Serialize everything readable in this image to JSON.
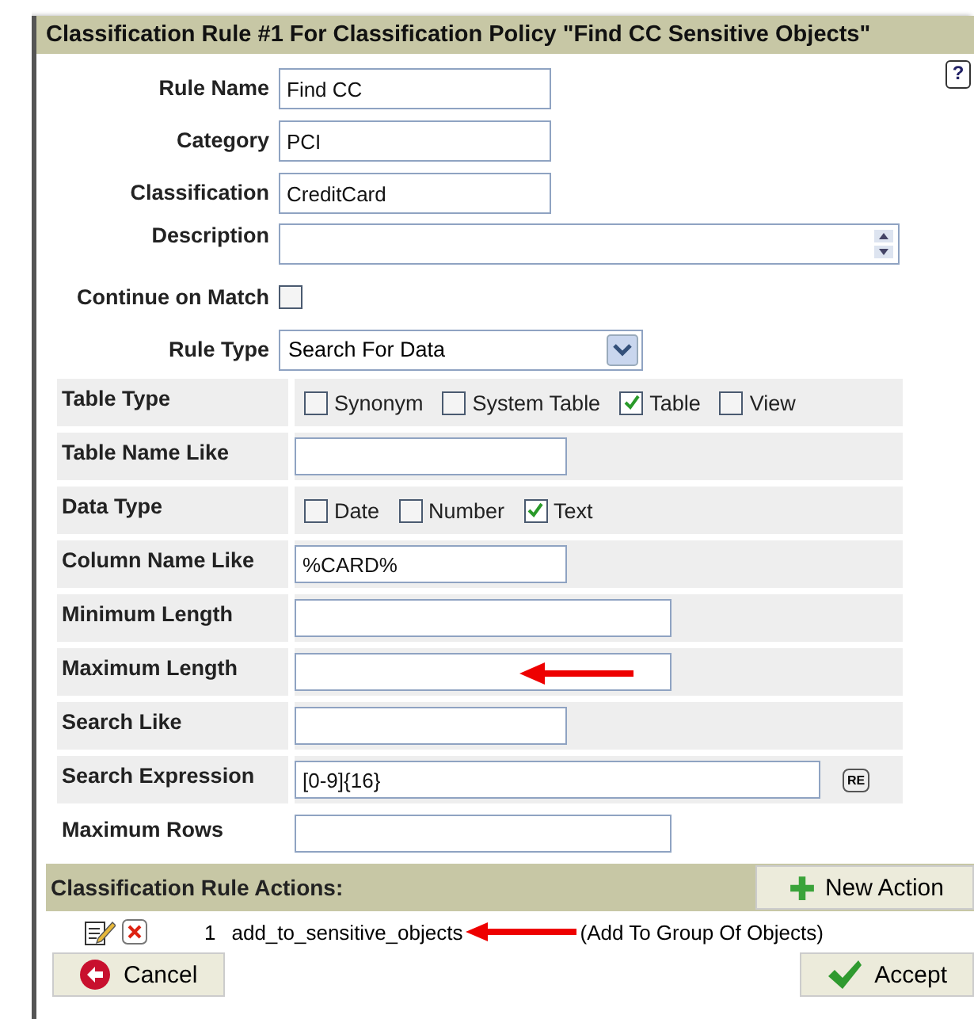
{
  "dialog": {
    "title": "Classification Rule #1 For Classification Policy \"Find CC Sensitive Objects\"",
    "help": "?"
  },
  "fields": [
    {
      "kind": "text",
      "label": "Rule Name",
      "value": "Find CC"
    },
    {
      "kind": "text",
      "label": "Category",
      "value": "PCI"
    },
    {
      "kind": "text",
      "label": "Classification",
      "value": "CreditCard"
    },
    {
      "kind": "textarea",
      "label": "Description"
    },
    {
      "kind": "checkbox",
      "label": "Continue on Match",
      "checked": false
    },
    {
      "kind": "select",
      "label": "Rule Type",
      "value": "Search For Data"
    }
  ],
  "criteria": [
    {
      "kind": "checks",
      "label": "Table Type",
      "options": [
        {
          "label": "Synonym",
          "checked": false
        },
        {
          "label": "System Table",
          "checked": false
        },
        {
          "label": "Table",
          "checked": true
        },
        {
          "label": "View",
          "checked": false
        }
      ]
    },
    {
      "kind": "text",
      "label": "Table Name Like"
    },
    {
      "kind": "checks",
      "label": "Data Type",
      "options": [
        {
          "label": "Date",
          "checked": false
        },
        {
          "label": "Number",
          "checked": false
        },
        {
          "label": "Text",
          "checked": true
        }
      ]
    },
    {
      "kind": "text",
      "label": "Column Name Like",
      "value": "%CARD%"
    },
    {
      "kind": "text",
      "label": "Minimum Length"
    },
    {
      "kind": "text",
      "label": "Maximum Length"
    },
    {
      "kind": "text",
      "label": "Search Like"
    },
    {
      "kind": "regex",
      "label": "Search Expression",
      "value": "[0-9]{16}",
      "badge": "RE"
    },
    {
      "kind": "text",
      "label": "Maximum Rows"
    }
  ],
  "actions": {
    "title": "Classification Rule Actions:",
    "button": "New Action",
    "rows": [
      {
        "number": "1",
        "name": "add_to_sensitive_objects",
        "type": "(Add To Group Of Objects)"
      }
    ]
  },
  "buttons": [
    {
      "kind": "cancel",
      "label": "Cancel"
    },
    {
      "kind": "accept",
      "label": "Accept"
    }
  ]
}
